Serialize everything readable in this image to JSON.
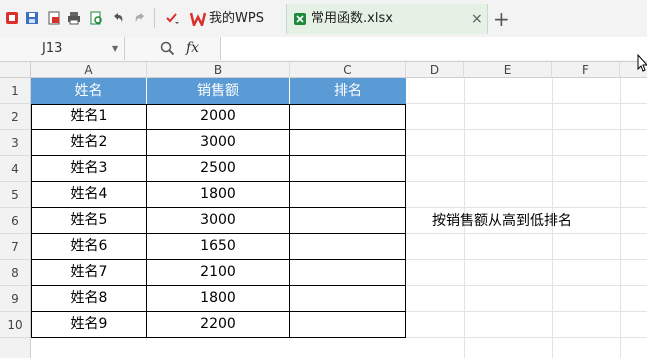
{
  "tabs": {
    "wps_label": "我的WPS",
    "file_label": "常用函数.xlsx",
    "close_glyph": "×",
    "add_glyph": "+"
  },
  "formula_bar": {
    "name_box": "J13",
    "fx_label": "fx",
    "value": ""
  },
  "columns": [
    "A",
    "B",
    "C",
    "D",
    "E",
    "F"
  ],
  "rows": [
    "1",
    "2",
    "3",
    "4",
    "5",
    "6",
    "7",
    "8",
    "9",
    "10"
  ],
  "table": {
    "headers": [
      "姓名",
      "销售额",
      "排名"
    ],
    "data": [
      [
        "姓名1",
        "2000",
        ""
      ],
      [
        "姓名2",
        "3000",
        ""
      ],
      [
        "姓名3",
        "2500",
        ""
      ],
      [
        "姓名4",
        "1800",
        ""
      ],
      [
        "姓名5",
        "3000",
        ""
      ],
      [
        "姓名6",
        "1650",
        ""
      ],
      [
        "姓名7",
        "2100",
        ""
      ],
      [
        "姓名8",
        "1800",
        ""
      ],
      [
        "姓名9",
        "2200",
        ""
      ]
    ]
  },
  "note": "按销售额从高到低排名",
  "colors": {
    "header_fill": "#5b9bd5",
    "wps_red": "#d9302c",
    "file_green": "#1d8a3a"
  }
}
